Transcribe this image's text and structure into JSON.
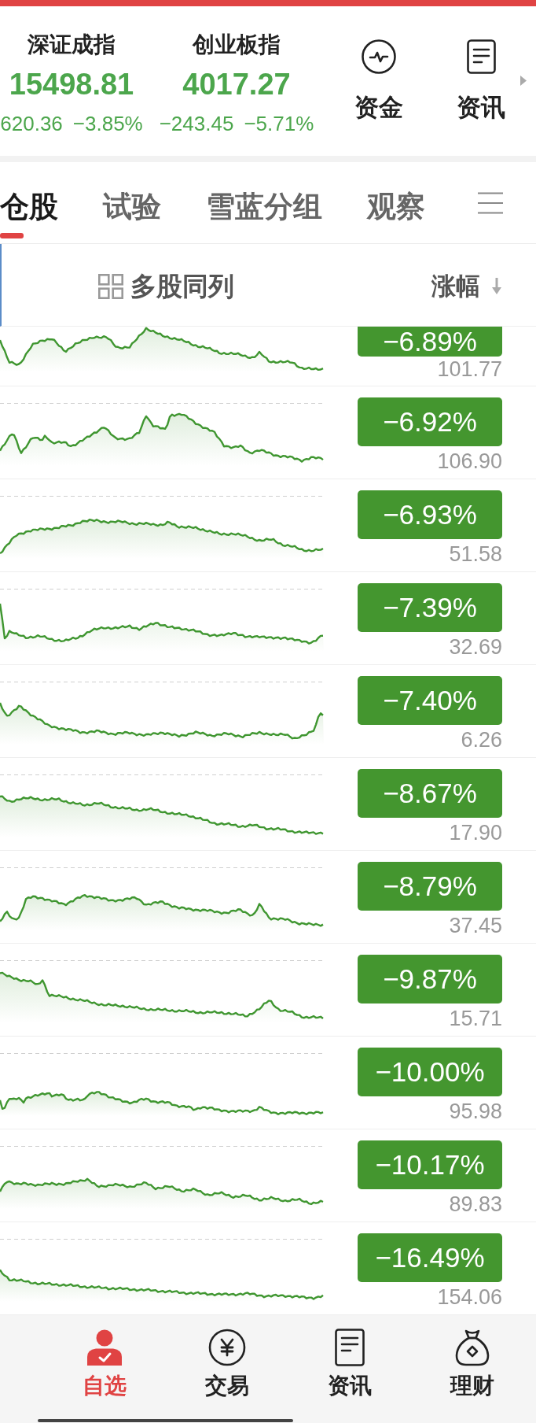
{
  "indices": [
    {
      "name": "深证成指",
      "value": "15498.81",
      "change": "620.36",
      "change_pct": "−3.85%"
    },
    {
      "name": "创业板指",
      "value": "4017.27",
      "change": "−243.45",
      "change_pct": "−5.71%"
    }
  ],
  "shortcuts": [
    {
      "label": "资金",
      "kind": "funds"
    },
    {
      "label": "资讯",
      "kind": "news"
    }
  ],
  "tabs": [
    {
      "label": "仓股",
      "selected": true
    },
    {
      "label": "试验",
      "selected": false
    },
    {
      "label": "雪蓝分组",
      "selected": false
    },
    {
      "label": "观察",
      "selected": false
    }
  ],
  "list_header": {
    "label": "多股同列",
    "sort_label": "涨幅",
    "sort_descending": true
  },
  "rows": [
    {
      "change_pct": "−6.89%",
      "price": "101.77"
    },
    {
      "change_pct": "−6.92%",
      "price": "106.90"
    },
    {
      "change_pct": "−6.93%",
      "price": "51.58"
    },
    {
      "change_pct": "−7.39%",
      "price": "32.69"
    },
    {
      "change_pct": "−7.40%",
      "price": "6.26"
    },
    {
      "change_pct": "−8.67%",
      "price": "17.90"
    },
    {
      "change_pct": "−8.79%",
      "price": "37.45"
    },
    {
      "change_pct": "−9.87%",
      "price": "15.71"
    },
    {
      "change_pct": "−10.00%",
      "price": "95.98"
    },
    {
      "change_pct": "−10.17%",
      "price": "89.83"
    },
    {
      "change_pct": "−16.49%",
      "price": "154.06"
    }
  ],
  "bottom_nav": [
    {
      "label": "自选",
      "kind": "watchlist",
      "selected": true
    },
    {
      "label": "交易",
      "kind": "trade",
      "selected": false
    },
    {
      "label": "资讯",
      "kind": "news",
      "selected": false
    },
    {
      "label": "理财",
      "kind": "wealth",
      "selected": false
    }
  ]
}
